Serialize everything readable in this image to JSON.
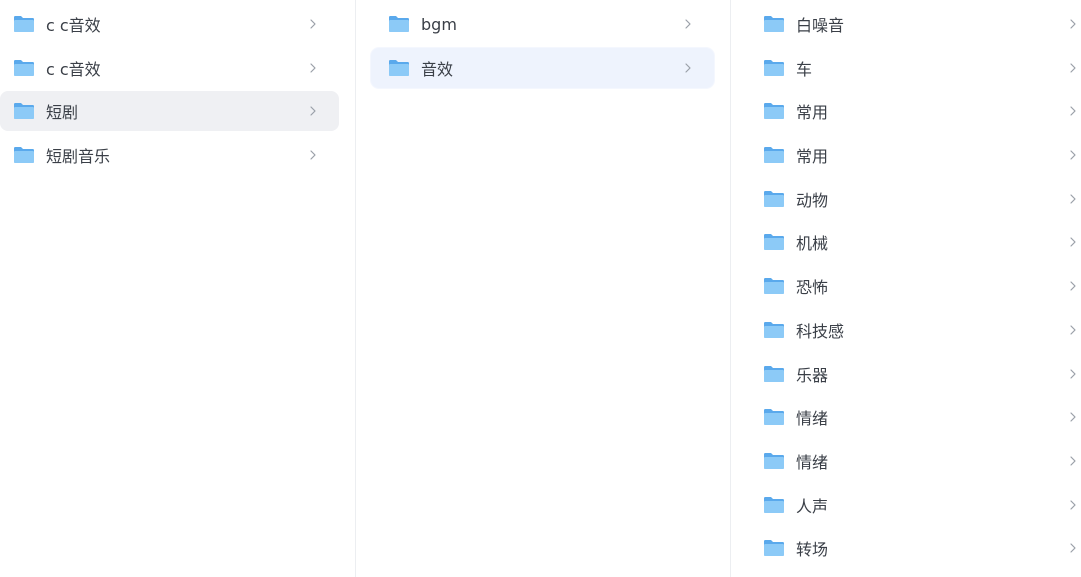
{
  "columns": [
    {
      "items": [
        {
          "label": "c c音效",
          "state": "normal"
        },
        {
          "label": "c c音效",
          "state": "normal"
        },
        {
          "label": "短剧",
          "state": "selected"
        },
        {
          "label": "短剧音乐",
          "state": "normal"
        }
      ]
    },
    {
      "items": [
        {
          "label": "bgm",
          "state": "normal"
        },
        {
          "label": "音效",
          "state": "selected"
        }
      ]
    },
    {
      "items": [
        {
          "label": "白噪音"
        },
        {
          "label": "车"
        },
        {
          "label": "常用"
        },
        {
          "label": "常用"
        },
        {
          "label": "动物"
        },
        {
          "label": "机械"
        },
        {
          "label": "恐怖"
        },
        {
          "label": "科技感"
        },
        {
          "label": "乐器"
        },
        {
          "label": "情绪"
        },
        {
          "label": "情绪"
        },
        {
          "label": "人声"
        },
        {
          "label": "转场"
        }
      ]
    }
  ],
  "icons": {
    "folder": "folder-icon",
    "chevron": "chevron-right-icon"
  },
  "colors": {
    "folder_back": "#5aa9ec",
    "folder_front": "#8ccaf7",
    "selected_gray": "#eff0f3",
    "selected_blue": "#eef3fd",
    "chevron": "#9aa0a8"
  }
}
